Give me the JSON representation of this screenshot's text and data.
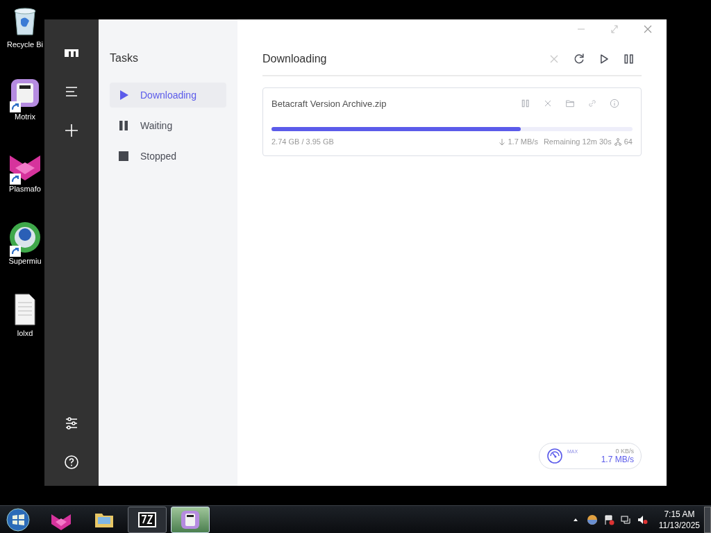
{
  "desktop_icons": [
    {
      "kind": "trash",
      "label": "Recycle Bi",
      "shortcut": false
    },
    {
      "kind": "motrix",
      "label": "Motrix",
      "shortcut": true
    },
    {
      "kind": "fox",
      "label": "Plasmafo",
      "shortcut": true
    },
    {
      "kind": "globe",
      "label": "Supermiu",
      "shortcut": true
    },
    {
      "kind": "file",
      "label": "lolxd",
      "shortcut": false
    }
  ],
  "window": {
    "nav_top": [
      {
        "kind": "logo"
      },
      {
        "kind": "list"
      },
      {
        "kind": "add"
      }
    ],
    "nav_bottom": [
      {
        "kind": "settings"
      },
      {
        "kind": "help"
      }
    ],
    "panel": {
      "title": "Tasks",
      "items": [
        {
          "kind": "play",
          "label": "Downloading",
          "selected": true
        },
        {
          "kind": "pause",
          "label": "Waiting",
          "selected": false
        },
        {
          "kind": "stop",
          "label": "Stopped",
          "selected": false
        }
      ]
    },
    "header": {
      "title": "Downloading",
      "actions": [
        {
          "kind": "close",
          "disabled": true
        },
        {
          "kind": "refresh",
          "disabled": false
        },
        {
          "kind": "play",
          "disabled": false
        },
        {
          "kind": "pause",
          "disabled": false
        }
      ]
    },
    "tasks": [
      {
        "name": "Betacraft Version Archive.zip",
        "level": 0.69,
        "progress": "2.74 GB / 3.95 GB",
        "speed": "1.7 MB/s",
        "remaining": "Remaining 12m 30s",
        "connections": "64",
        "actions": [
          {
            "kind": "pause"
          },
          {
            "kind": "close"
          },
          {
            "kind": "folder"
          },
          {
            "kind": "link"
          },
          {
            "kind": "info"
          }
        ]
      }
    ],
    "speed_meter": {
      "label": "MAX",
      "upload": "0 KB/s",
      "download": "1.7 MB/s"
    }
  },
  "taskbar": {
    "apps": [
      {
        "kind": "fox",
        "running": false,
        "selected": false
      },
      {
        "kind": "folder",
        "running": false,
        "selected": false
      },
      {
        "kind": "archiver",
        "running": true,
        "selected": false
      },
      {
        "kind": "motrix",
        "running": true,
        "selected": true
      }
    ],
    "tray": [
      {
        "kind": "up"
      },
      {
        "kind": "ball"
      },
      {
        "kind": "flag"
      },
      {
        "kind": "network"
      },
      {
        "kind": "volume"
      }
    ],
    "clock": {
      "time": "7:15 AM",
      "date": "11/13/2025"
    }
  }
}
